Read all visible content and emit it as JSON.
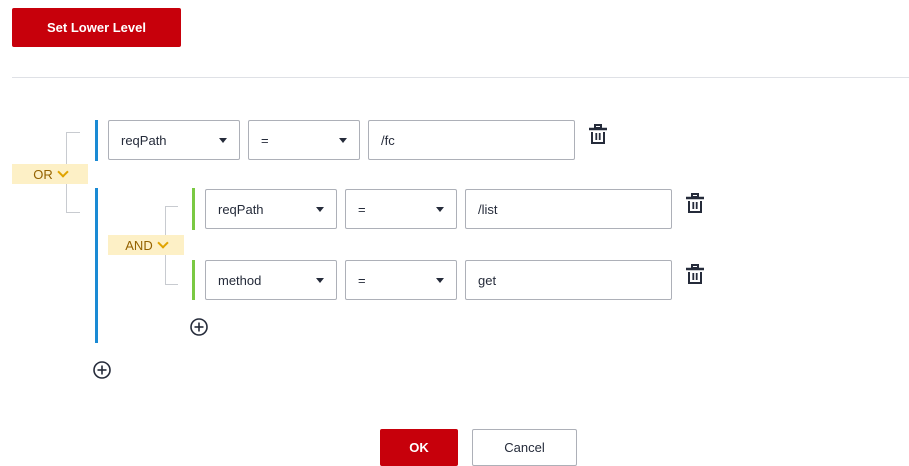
{
  "toolbar": {
    "set_lower_level_label": "Set Lower Level"
  },
  "root": {
    "logic": "OR",
    "condition": {
      "field": "reqPath",
      "operator": "=",
      "value": "/fc"
    }
  },
  "group": {
    "logic": "AND",
    "conditions": [
      {
        "field": "reqPath",
        "operator": "=",
        "value": "/list"
      },
      {
        "field": "method",
        "operator": "=",
        "value": "get"
      }
    ]
  },
  "footer": {
    "ok_label": "OK",
    "cancel_label": "Cancel"
  },
  "colors": {
    "accent": "#c7000b",
    "or_bar": "#1a8ad4",
    "and_bar": "#7ac943",
    "logic_bg": "#fdf0c6"
  }
}
